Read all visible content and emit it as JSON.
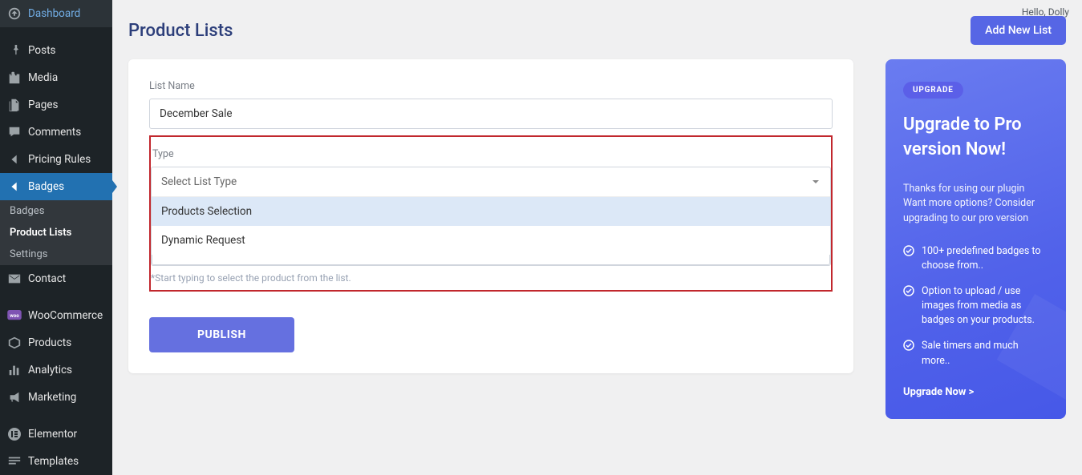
{
  "hello": "Hello, Dolly",
  "page_title": "Product Lists",
  "add_button": "Add New List",
  "sidebar": {
    "items": [
      {
        "label": "Dashboard",
        "icon": "dashboard"
      },
      {
        "label": "Posts",
        "icon": "pin"
      },
      {
        "label": "Media",
        "icon": "media"
      },
      {
        "label": "Pages",
        "icon": "pages"
      },
      {
        "label": "Comments",
        "icon": "comment"
      },
      {
        "label": "Pricing Rules",
        "icon": "back"
      },
      {
        "label": "Badges",
        "icon": "back"
      },
      {
        "label": "Contact",
        "icon": "mail"
      },
      {
        "label": "WooCommerce",
        "icon": "woo"
      },
      {
        "label": "Products",
        "icon": "box"
      },
      {
        "label": "Analytics",
        "icon": "bars"
      },
      {
        "label": "Marketing",
        "icon": "megaphone"
      },
      {
        "label": "Elementor",
        "icon": "elementor"
      },
      {
        "label": "Templates",
        "icon": "templates"
      }
    ],
    "submenu": [
      "Badges",
      "Product Lists",
      "Settings"
    ]
  },
  "form": {
    "list_name_label": "List Name",
    "list_name_value": "December Sale",
    "type_label": "Type",
    "type_placeholder": "Select List Type",
    "type_options": [
      "Products Selection",
      "Dynamic Request"
    ],
    "hint": "*Start typing to select the product from the list.",
    "publish": "PUBLISH"
  },
  "upgrade": {
    "pill": "UPGRADE",
    "title": "Upgrade to Pro version Now!",
    "text": "Thanks for using our plugin Want more options? Consider upgrading to our pro version",
    "features": [
      "100+ predefined badges to choose from..",
      "Option to upload / use images from media as badges on your products.",
      "Sale timers and much more.."
    ],
    "cta": "Upgrade Now >"
  }
}
